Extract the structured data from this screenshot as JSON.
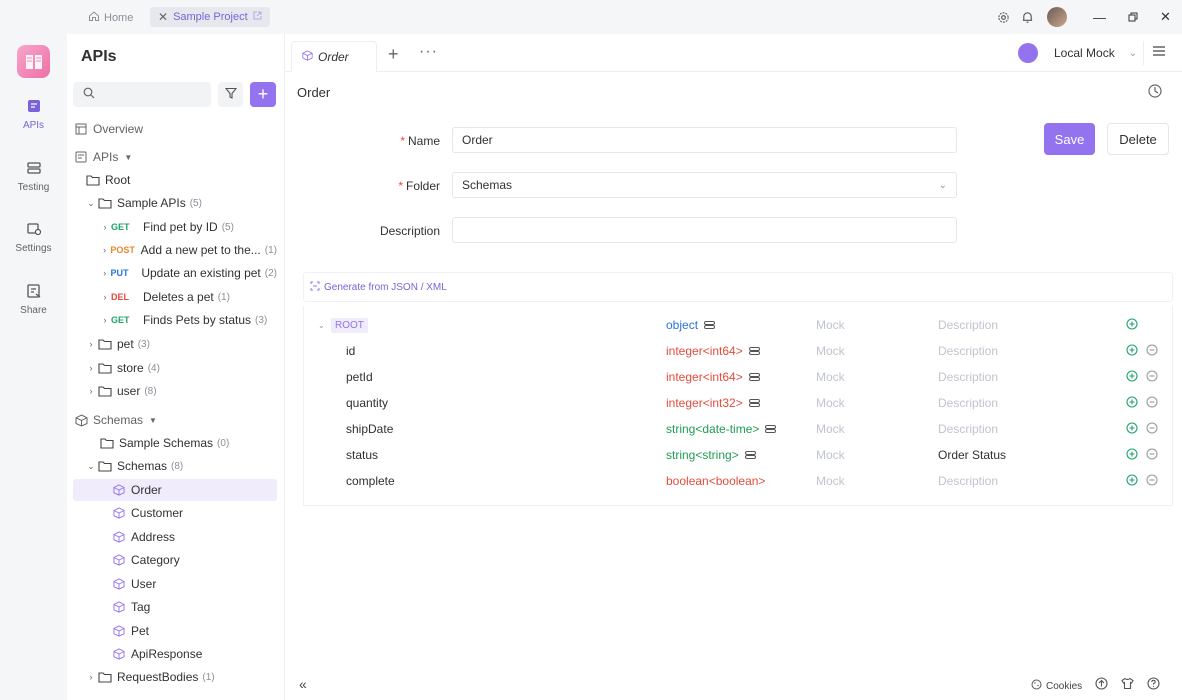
{
  "titlebar": {
    "home_label": "Home",
    "project_tab": "Sample Project"
  },
  "leftnav": {
    "items": [
      {
        "label": "APIs"
      },
      {
        "label": "Testing"
      },
      {
        "label": "Settings"
      },
      {
        "label": "Share"
      }
    ]
  },
  "sidebar": {
    "title": "APIs",
    "search_placeholder": "",
    "tree": {
      "overview": "Overview",
      "apis": "APIs",
      "root": "Root",
      "sample_apis": {
        "label": "Sample APIs",
        "count": "(5)"
      },
      "endpoints": [
        {
          "method": "GET",
          "label": "Find pet by ID",
          "count": "(5)"
        },
        {
          "method": "POST",
          "label": "Add a new pet to the...",
          "count": "(1)"
        },
        {
          "method": "PUT",
          "label": "Update an existing pet",
          "count": "(2)"
        },
        {
          "method": "DEL",
          "label": "Deletes a pet",
          "count": "(1)"
        },
        {
          "method": "GET",
          "label": "Finds Pets by status",
          "count": "(3)"
        }
      ],
      "folders": [
        {
          "label": "pet",
          "count": "(3)"
        },
        {
          "label": "store",
          "count": "(4)"
        },
        {
          "label": "user",
          "count": "(8)"
        }
      ],
      "schemas": "Schemas",
      "sample_schemas": {
        "label": "Sample Schemas",
        "count": "(0)"
      },
      "schemas_folder": {
        "label": "Schemas",
        "count": "(8)"
      },
      "schema_items": [
        "Order",
        "Customer",
        "Address",
        "Category",
        "User",
        "Tag",
        "Pet",
        "ApiResponse"
      ],
      "request_bodies": {
        "label": "RequestBodies",
        "count": "(1)"
      }
    }
  },
  "main": {
    "tab_label": "Order",
    "environment": "Local Mock",
    "page_title": "Order",
    "form": {
      "name_label": "Name",
      "name_value": "Order",
      "folder_label": "Folder",
      "folder_value": "Schemas",
      "description_label": "Description",
      "description_value": ""
    },
    "save_label": "Save",
    "delete_label": "Delete",
    "generate_label": "Generate from JSON / XML",
    "schema": {
      "root": {
        "name": "ROOT",
        "type": "object",
        "mock": "Mock",
        "description": "Description"
      },
      "fields": [
        {
          "name": "id",
          "type": "integer<int64>",
          "mock": "Mock",
          "description": "Description"
        },
        {
          "name": "petId",
          "type": "integer<int64>",
          "mock": "Mock",
          "description": "Description"
        },
        {
          "name": "quantity",
          "type": "integer<int32>",
          "mock": "Mock",
          "description": "Description"
        },
        {
          "name": "shipDate",
          "type": "string<date-time>",
          "mock": "Mock",
          "description": "Description"
        },
        {
          "name": "status",
          "type": "string<string>",
          "mock": "Mock",
          "description": "Order Status"
        },
        {
          "name": "complete",
          "type": "boolean<boolean>",
          "mock": "Mock",
          "description": "Description"
        }
      ]
    },
    "footer": {
      "cookies_label": "Cookies"
    }
  },
  "colors": {
    "accent": "#9373ee",
    "get": "#1fa36b",
    "post": "#e9892b",
    "put": "#2a73e0",
    "delete": "#e24b3c"
  }
}
